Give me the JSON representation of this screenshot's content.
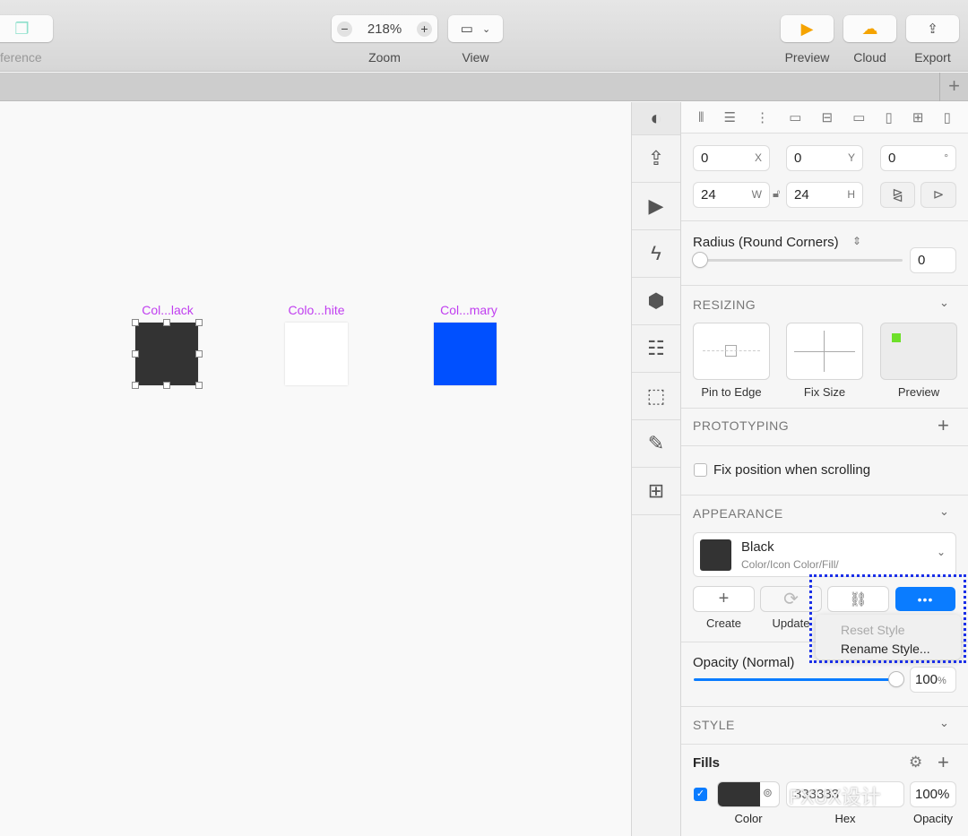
{
  "toolbar": {
    "difference_label": "ference",
    "zoom_value": "218%",
    "zoom_label": "Zoom",
    "view_label": "View",
    "preview_label": "Preview",
    "cloud_label": "Cloud",
    "export_label": "Export"
  },
  "tabbar": {
    "add_icon": "plus-icon"
  },
  "canvas": {
    "artboards": [
      {
        "label": "Col...lack",
        "color": "#333333"
      },
      {
        "label": "Colo...hite",
        "color": "#ffffff"
      },
      {
        "label": "Col...mary",
        "color": "#0050ff"
      }
    ]
  },
  "iconcol": [
    "components",
    "upload",
    "play",
    "lightning",
    "hexagon",
    "layout-list",
    "symbol-select",
    "edit-artboard",
    "add-image"
  ],
  "inspector": {
    "position": {
      "x": "0",
      "x_suffix": "X",
      "y": "0",
      "y_suffix": "Y",
      "rotation": "0",
      "rotation_suffix": "°",
      "w": "24",
      "w_suffix": "W",
      "h": "24",
      "h_suffix": "H"
    },
    "radius": {
      "label": "Radius (Round Corners)",
      "value": "0"
    },
    "resizing": {
      "title": "RESIZING",
      "pin_label": "Pin to Edge",
      "fix_label": "Fix Size",
      "preview_label": "Preview"
    },
    "prototyping": {
      "title": "PROTOTYPING",
      "fix_scroll_label": "Fix position when scrolling",
      "fix_scroll_checked": false
    },
    "appearance": {
      "title": "APPEARANCE",
      "style_name": "Black",
      "style_path": "Color/Icon Color/Fill/",
      "style_color": "#333333",
      "create_label": "Create",
      "update_label": "Update",
      "menu": {
        "reset": "Reset Style",
        "rename": "Rename Style..."
      }
    },
    "opacity": {
      "label": "Opacity (Normal)",
      "value": "100",
      "unit": "%",
      "level": 100
    },
    "style": {
      "title": "STYLE"
    },
    "fills": {
      "title": "Fills",
      "checked": true,
      "color": "#333333",
      "hex": "333333",
      "opacity": "100%",
      "color_label": "Color",
      "hex_label": "Hex",
      "opacity_label": "Opacity"
    }
  },
  "watermark": "FXUX设计",
  "colors": {
    "accent": "#0a7cff",
    "highlight": "#1a2fe8",
    "label_magenta": "#c03ef0"
  }
}
